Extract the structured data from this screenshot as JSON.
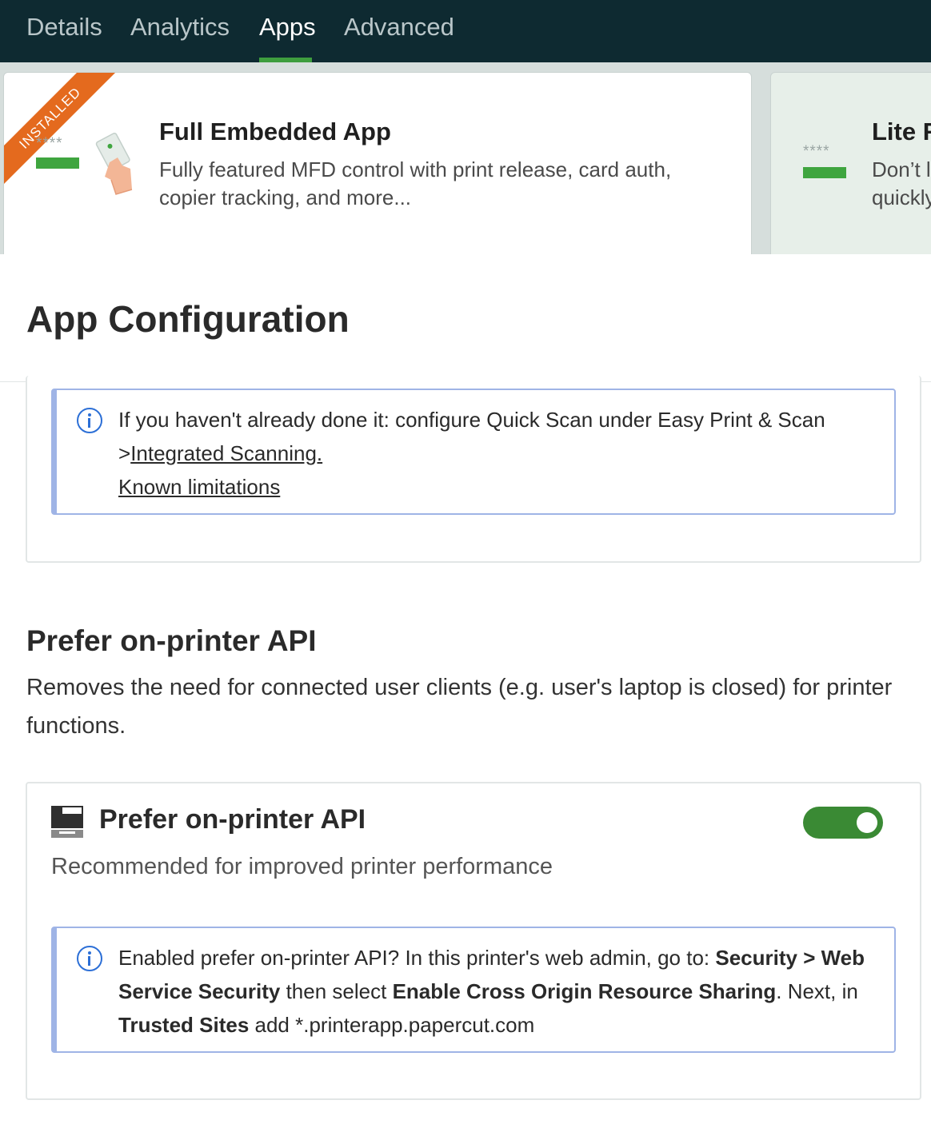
{
  "nav": {
    "tabs": [
      {
        "label": "Details",
        "active": false
      },
      {
        "label": "Analytics",
        "active": false
      },
      {
        "label": "Apps",
        "active": true
      },
      {
        "label": "Advanced",
        "active": false
      }
    ]
  },
  "apps": {
    "full": {
      "badge": "INSTALLED",
      "title": "Full Embedded App",
      "desc_line1": "Fully featured MFD control with print release, card auth,",
      "desc_line2": "copier tracking, and more...",
      "pin_mask": "****"
    },
    "lite": {
      "title": "Lite R",
      "desc_line1": "Don’t l",
      "desc_line2": "quickly",
      "pin_mask": "****"
    }
  },
  "config": {
    "title": "App Configuration",
    "scan_info": {
      "line1": "If you haven't already done it: configure Quick Scan under Easy Print & Scan",
      "line2_prefix": ">",
      "line2_link": "Integrated Scanning.",
      "line3_link": "Known limitations"
    }
  },
  "prefer_api": {
    "section_title": "Prefer on-printer API",
    "section_desc": "Removes the need for connected user clients (e.g. user's laptop is closed) for printer functions.",
    "card_title": "Prefer on-printer API",
    "card_subtitle": "Recommended for improved printer performance",
    "toggle_on": true,
    "info": {
      "t1": "Enabled prefer on-printer API? In this printer's web admin, go to: ",
      "b1": "Security > Web Service Security",
      "t2": " then select ",
      "b2": "Enable Cross Origin Resource Sharing",
      "t3": ". Next, in ",
      "b3": "Trusted Sites",
      "t4": " add *.printerapp.papercut.com"
    }
  },
  "colors": {
    "nav_bg": "#0e2a31",
    "accent_green": "#3e9e3e",
    "installed_orange": "#e46a1e",
    "info_blue": "#2c6fd6",
    "toggle_green": "#3a8a34"
  }
}
